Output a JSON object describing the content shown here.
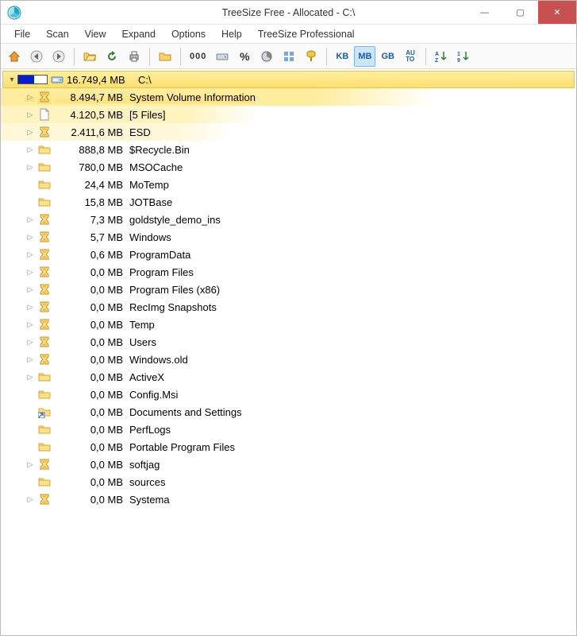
{
  "window": {
    "title": "TreeSize Free - Allocated - C:\\",
    "min": "—",
    "max": "▢",
    "close": "✕"
  },
  "menu": {
    "items": [
      "File",
      "Scan",
      "View",
      "Expand",
      "Options",
      "Help",
      "TreeSize Professional"
    ]
  },
  "toolbar": {
    "kb": "KB",
    "mb": "MB",
    "gb": "GB",
    "auto": "AU\nTO",
    "az": "A\nZ",
    "n19": "1\n9",
    "pct": "%",
    "ooo": "000"
  },
  "root": {
    "size": "16.749,4 MB",
    "path": "C:\\"
  },
  "items": [
    {
      "exp": true,
      "icon": "hourglass",
      "hl": 0,
      "size": "8.494,7 MB",
      "name": "System Volume Information"
    },
    {
      "exp": true,
      "icon": "file",
      "hl": 1,
      "size": "4.120,5 MB",
      "name": "[5 Files]"
    },
    {
      "exp": true,
      "icon": "hourglass",
      "hl": 2,
      "size": "2.411,6 MB",
      "name": "ESD"
    },
    {
      "exp": true,
      "icon": "folder",
      "hl": -1,
      "size": "888,8 MB",
      "name": "$Recycle.Bin"
    },
    {
      "exp": true,
      "icon": "folder",
      "hl": -1,
      "size": "780,0 MB",
      "name": "MSOCache"
    },
    {
      "exp": false,
      "icon": "folder",
      "hl": -1,
      "size": "24,4 MB",
      "name": "MoTemp"
    },
    {
      "exp": false,
      "icon": "folder",
      "hl": -1,
      "size": "15,8 MB",
      "name": "JOTBase"
    },
    {
      "exp": true,
      "icon": "hourglass",
      "hl": -1,
      "size": "7,3 MB",
      "name": "goldstyle_demo_ins"
    },
    {
      "exp": true,
      "icon": "hourglass",
      "hl": -1,
      "size": "5,7 MB",
      "name": "Windows"
    },
    {
      "exp": true,
      "icon": "hourglass",
      "hl": -1,
      "size": "0,6 MB",
      "name": "ProgramData"
    },
    {
      "exp": true,
      "icon": "hourglass",
      "hl": -1,
      "size": "0,0 MB",
      "name": "Program Files"
    },
    {
      "exp": true,
      "icon": "hourglass",
      "hl": -1,
      "size": "0,0 MB",
      "name": "Program Files (x86)"
    },
    {
      "exp": true,
      "icon": "hourglass",
      "hl": -1,
      "size": "0,0 MB",
      "name": "RecImg Snapshots"
    },
    {
      "exp": true,
      "icon": "hourglass",
      "hl": -1,
      "size": "0,0 MB",
      "name": "Temp"
    },
    {
      "exp": true,
      "icon": "hourglass",
      "hl": -1,
      "size": "0,0 MB",
      "name": "Users"
    },
    {
      "exp": true,
      "icon": "hourglass",
      "hl": -1,
      "size": "0,0 MB",
      "name": "Windows.old"
    },
    {
      "exp": true,
      "icon": "folder",
      "hl": -1,
      "size": "0,0 MB",
      "name": "ActiveX"
    },
    {
      "exp": false,
      "icon": "folder",
      "hl": -1,
      "size": "0,0 MB",
      "name": "Config.Msi"
    },
    {
      "exp": false,
      "icon": "shortcut",
      "hl": -1,
      "size": "0,0 MB",
      "name": "Documents and Settings"
    },
    {
      "exp": false,
      "icon": "folder",
      "hl": -1,
      "size": "0,0 MB",
      "name": "PerfLogs"
    },
    {
      "exp": false,
      "icon": "folder",
      "hl": -1,
      "size": "0,0 MB",
      "name": "Portable Program Files"
    },
    {
      "exp": true,
      "icon": "hourglass",
      "hl": -1,
      "size": "0,0 MB",
      "name": "softjag"
    },
    {
      "exp": false,
      "icon": "folder",
      "hl": -1,
      "size": "0,0 MB",
      "name": "sources"
    },
    {
      "exp": true,
      "icon": "hourglass",
      "hl": -1,
      "size": "0,0 MB",
      "name": "Systema"
    }
  ]
}
